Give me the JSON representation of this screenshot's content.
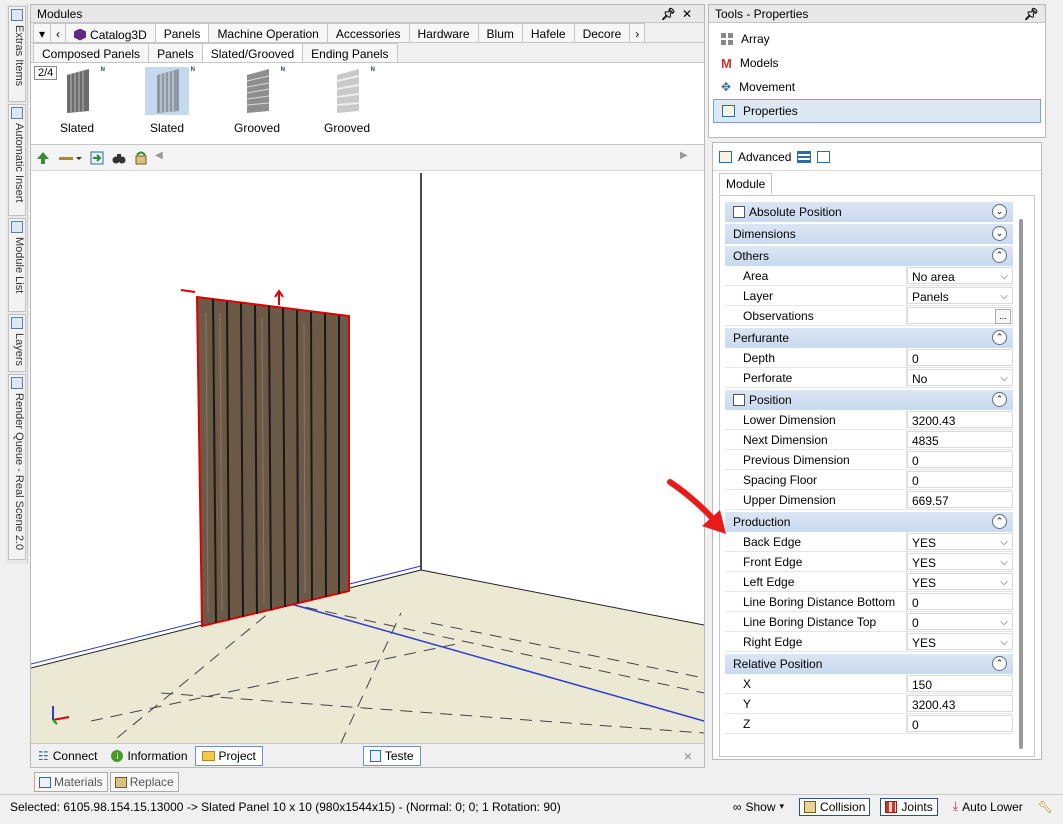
{
  "left_strip": {
    "tabs": [
      {
        "label": "Extras Items"
      },
      {
        "label": "Automatic Insert"
      },
      {
        "label": "Module List"
      },
      {
        "label": "Layers"
      },
      {
        "label": "Render Queue - Real Scene 2.0"
      }
    ]
  },
  "modules": {
    "title": "Modules",
    "pin": "X",
    "tabs": [
      "Catalog3D",
      "Panels",
      "Machine Operation",
      "Accessories",
      "Hardware",
      "Blum",
      "Hafele",
      "Decore"
    ],
    "active_tab": "Panels",
    "subtabs": [
      "Composed Panels",
      "Panels",
      "Slated/Grooved",
      "Ending Panels"
    ],
    "active_subtab": "Slated/Grooved",
    "pager": "2/4",
    "thumbs": [
      {
        "label": "Slated",
        "badge": "N"
      },
      {
        "label": "Slated",
        "badge": "N"
      },
      {
        "label": "Grooved",
        "badge": "N"
      },
      {
        "label": "Grooved",
        "badge": "N"
      }
    ],
    "bottom_tabs": [
      {
        "label": "Connect"
      },
      {
        "label": "Information"
      },
      {
        "label": "Project"
      }
    ],
    "teste": "Teste",
    "close": "×"
  },
  "tools": {
    "title": "Tools - Properties",
    "items": [
      {
        "label": "Array"
      },
      {
        "label": "Models"
      },
      {
        "label": "Movement"
      },
      {
        "label": "Properties"
      }
    ]
  },
  "props": {
    "advanced": "Advanced",
    "module_tab": "Module",
    "sections": {
      "absolute_position": "Absolute Position",
      "dimensions": "Dimensions",
      "others": "Others",
      "perfurante": "Perfurante",
      "position": "Position",
      "production": "Production",
      "relative_position": "Relative Position"
    },
    "others": [
      {
        "k": "Area",
        "v": "No area"
      },
      {
        "k": "Layer",
        "v": "Panels"
      },
      {
        "k": "Observations",
        "v": ""
      }
    ],
    "perfurante": [
      {
        "k": "Depth",
        "v": "0"
      },
      {
        "k": "Perforate",
        "v": "No"
      }
    ],
    "position": [
      {
        "k": "Lower Dimension",
        "v": "3200.43"
      },
      {
        "k": "Next Dimension",
        "v": "4835"
      },
      {
        "k": "Previous Dimension",
        "v": "0"
      },
      {
        "k": "Spacing Floor",
        "v": "0"
      },
      {
        "k": "Upper Dimension",
        "v": "669.57"
      }
    ],
    "production": [
      {
        "k": "Back Edge",
        "v": "YES"
      },
      {
        "k": "Front Edge",
        "v": "YES"
      },
      {
        "k": "Left Edge",
        "v": "YES"
      },
      {
        "k": "Line Boring Distance Bottom",
        "v": "0"
      },
      {
        "k": "Line Boring Distance Top",
        "v": "0"
      },
      {
        "k": "Right Edge",
        "v": "YES"
      }
    ],
    "relative": [
      {
        "k": "X",
        "v": "150"
      },
      {
        "k": "Y",
        "v": "3200.43"
      },
      {
        "k": "Z",
        "v": "0"
      }
    ]
  },
  "lower_tabs": [
    {
      "label": "Materials"
    },
    {
      "label": "Replace"
    }
  ],
  "status": {
    "text": "Selected: 6105.98.154.15.13000 -> Slated Panel 10 x 10 (980x1544x15) - (Normal: 0; 0; 1 Rotation: 90)",
    "show": "Show",
    "collision": "Collision",
    "joints": "Joints",
    "auto_lower": "Auto Lower"
  },
  "colors": {
    "accent": "#dde8f5",
    "section": "#c9d9ef",
    "annotation_arrow": "#e81b1b",
    "selection_outline": "#e00000"
  }
}
